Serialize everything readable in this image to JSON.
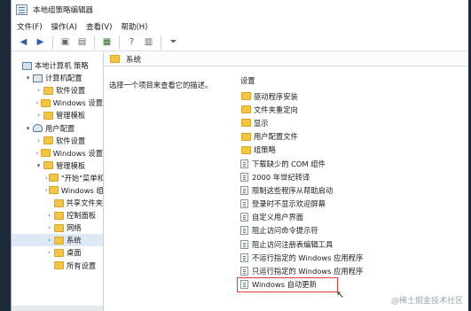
{
  "window": {
    "title": "本地组策略编辑器"
  },
  "menu": [
    "文件(F)",
    "操作(A)",
    "查看(V)",
    "帮助(H)"
  ],
  "tree": [
    {
      "label": "本地计算机 策略",
      "icon": "computer-icon",
      "indent": 0,
      "twist": ""
    },
    {
      "label": "计算机配置",
      "icon": "config-icon",
      "indent": 1,
      "twist": "▾"
    },
    {
      "label": "软件设置",
      "icon": "folder-icon",
      "indent": 2,
      "twist": "›"
    },
    {
      "label": "Windows 设置",
      "icon": "folder-icon",
      "indent": 2,
      "twist": "›"
    },
    {
      "label": "管理模板",
      "icon": "folder-icon",
      "indent": 2,
      "twist": "›"
    },
    {
      "label": "用户配置",
      "icon": "user-icon",
      "indent": 1,
      "twist": "▾"
    },
    {
      "label": "软件设置",
      "icon": "folder-icon",
      "indent": 2,
      "twist": "›"
    },
    {
      "label": "Windows 设置",
      "icon": "folder-icon",
      "indent": 2,
      "twist": "›"
    },
    {
      "label": "管理模板",
      "icon": "folder-icon",
      "indent": 2,
      "twist": "▾"
    },
    {
      "label": "\"开始\"菜单和",
      "icon": "folder-icon",
      "indent": 3,
      "twist": "›"
    },
    {
      "label": "Windows 组",
      "icon": "folder-icon",
      "indent": 3,
      "twist": "›"
    },
    {
      "label": "共享文件夹",
      "icon": "folder-icon",
      "indent": 3,
      "twist": ""
    },
    {
      "label": "控制面板",
      "icon": "folder-icon",
      "indent": 3,
      "twist": "›"
    },
    {
      "label": "网络",
      "icon": "folder-icon",
      "indent": 3,
      "twist": "›"
    },
    {
      "label": "系统",
      "icon": "folder-icon",
      "indent": 3,
      "twist": "›",
      "selected": true
    },
    {
      "label": "桌面",
      "icon": "folder-icon",
      "indent": 3,
      "twist": "›"
    },
    {
      "label": "所有设置",
      "icon": "folder-icon",
      "indent": 3,
      "twist": ""
    }
  ],
  "pane": {
    "header": "系统",
    "description": "选择一个项目来查看它的描述。",
    "column": "设置",
    "items": [
      {
        "label": "驱动程序安装",
        "type": "folder"
      },
      {
        "label": "文件夹重定向",
        "type": "folder"
      },
      {
        "label": "显示",
        "type": "folder"
      },
      {
        "label": "用户配置文件",
        "type": "folder"
      },
      {
        "label": "组策略",
        "type": "folder"
      },
      {
        "label": "下载缺少的 COM 组件",
        "type": "setting"
      },
      {
        "label": "2000 年世纪转译",
        "type": "setting"
      },
      {
        "label": "限制这些程序从帮助启动",
        "type": "setting"
      },
      {
        "label": "登录时不显示欢迎屏幕",
        "type": "setting"
      },
      {
        "label": "自定义用户界面",
        "type": "setting"
      },
      {
        "label": "阻止访问命令提示符",
        "type": "setting"
      },
      {
        "label": "阻止访问注册表编辑工具",
        "type": "setting"
      },
      {
        "label": "不运行指定的 Windows 应用程序",
        "type": "setting"
      },
      {
        "label": "只运行指定的 Windows 应用程序",
        "type": "setting"
      },
      {
        "label": "Windows 自动更新",
        "type": "setting",
        "highlighted": true
      }
    ]
  },
  "watermark": "@稀土掘金技术社区"
}
